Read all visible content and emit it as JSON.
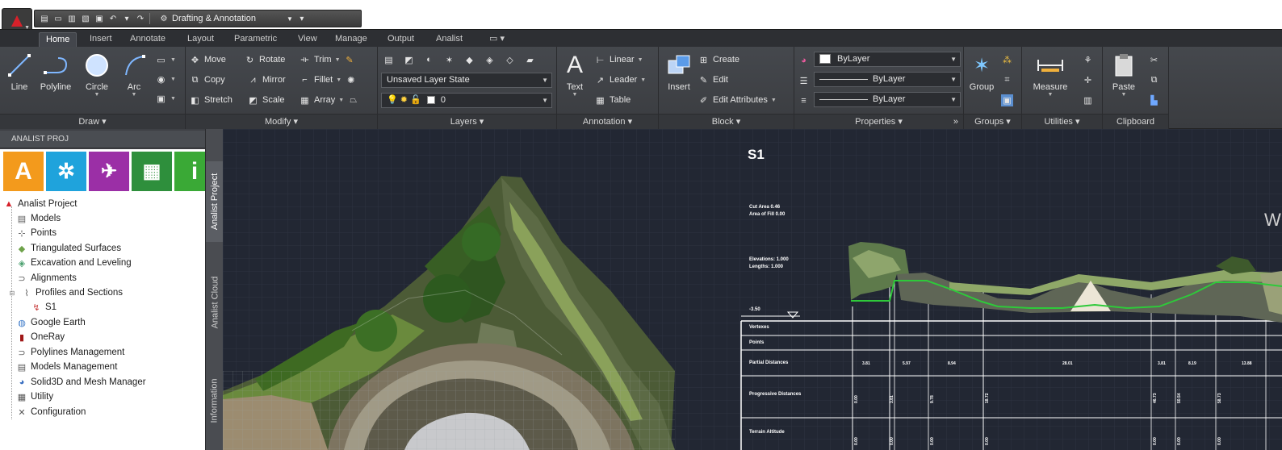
{
  "workspace": {
    "name": "Drafting & Annotation"
  },
  "tabs": [
    "Home",
    "Insert",
    "Annotate",
    "Layout",
    "Parametric",
    "View",
    "Manage",
    "Output",
    "Analist"
  ],
  "active_tab": "Home",
  "ribbon": {
    "draw": {
      "title": "Draw",
      "line": "Line",
      "polyline": "Polyline",
      "circle": "Circle",
      "arc": "Arc"
    },
    "modify": {
      "title": "Modify",
      "move": "Move",
      "rotate": "Rotate",
      "trim": "Trim",
      "copy": "Copy",
      "mirror": "Mirror",
      "fillet": "Fillet",
      "stretch": "Stretch",
      "scale": "Scale",
      "array": "Array"
    },
    "layers": {
      "title": "Layers",
      "layer_state": "Unsaved Layer State",
      "current_layer": "0"
    },
    "annotation": {
      "title": "Annotation",
      "text": "Text",
      "linear": "Linear",
      "leader": "Leader",
      "table": "Table"
    },
    "block": {
      "title": "Block",
      "insert": "Insert",
      "create": "Create",
      "edit": "Edit",
      "edit_attributes": "Edit Attributes"
    },
    "properties": {
      "title": "Properties",
      "color": "ByLayer",
      "linetype": "ByLayer",
      "lineweight": "ByLayer"
    },
    "groups": {
      "title": "Groups",
      "group": "Group"
    },
    "utilities": {
      "title": "Utilities",
      "measure": "Measure"
    },
    "clipboard": {
      "title": "Clipboard",
      "paste": "Paste"
    }
  },
  "palette": {
    "title": "ANALIST PROJ",
    "tiles": [
      {
        "glyph": "A",
        "color": "#f39a1c"
      },
      {
        "glyph": "✲",
        "color": "#1fa3dc"
      },
      {
        "glyph": "✈",
        "color": "#9b2fa6"
      },
      {
        "glyph": "▦",
        "color": "#2e8f3c"
      },
      {
        "glyph": "i",
        "color": "#3aa936"
      }
    ],
    "tree": {
      "root": "Analist Project",
      "items": [
        "Models",
        "Points",
        "Triangulated Surfaces",
        "Excavation and Leveling",
        "Alignments",
        "Profiles and Sections",
        "S1",
        "Google Earth",
        "OneRay",
        "Polylines Management",
        "Models Management",
        "Solid3D and Mesh Manager",
        "Utility",
        "Configuration"
      ]
    },
    "side_tabs": [
      "Analist Project",
      "Analist Cloud",
      "Information"
    ]
  },
  "section": {
    "title": "S1",
    "note1": [
      "Cut Area 0.46",
      "Area of Fill 0.00"
    ],
    "note2": [
      "Elevations: 1.000",
      "Lengths: 1.000"
    ],
    "datum": "-3.50",
    "rows": [
      "Vertexes",
      "Points",
      "Partial Distances",
      "Progressive Distances",
      "Terrain Altitude"
    ],
    "partial_distances": [
      "3.81",
      "5.97",
      "8.94",
      "28.01",
      "3.81",
      "8.19",
      "13.88"
    ],
    "progressive_distances": [
      "0.00",
      "3.81",
      "9.78",
      "18.72",
      "46.73",
      "50.54",
      "58.73"
    ],
    "terrain_altitudes": [
      "0.00",
      "0.00",
      "0.00",
      "0.00",
      "0.00",
      "0.00",
      "0.00"
    ]
  }
}
